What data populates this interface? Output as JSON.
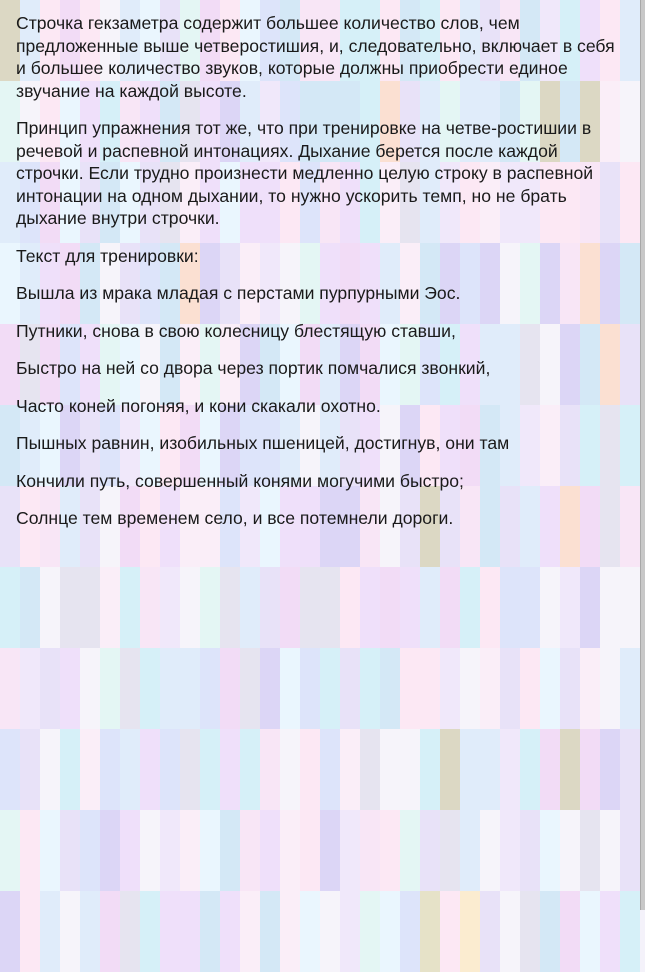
{
  "document": {
    "paragraphs": [
      "Строчка гекзаметра содержит большее количество слов, чем предложенные выше четверостишия, и, следовательно, включает в себя и большее количество звуков, которые должны приобрести единое звучание на каждой высоте.",
      "Принцип упражнения тот же, что при тренировке на четве-ростишии в речевой и распевной интонациях. Дыхание берется после каждой строчки. Если трудно произнести медленно целую строку в распевной интонации на одном дыхании, то нужно ускорить темп, но не брать дыхание внутри строчки."
    ],
    "training_label": "Текст для тренировки:",
    "verse_lines": [
      "Вышла из мрака младая с перстами пурпурными Эос.",
      "Путники, снова в свою колесницу блестящую ставши,",
      "Быстро на ней со двора через портик помчалися звонкий,",
      "Часто коней погоняя, и кони скакали охотно.",
      "Пышных равнин, изобильных пшеницей, достигнув, они там",
      "Кончили путь, совершенный конями могучими быстро;",
      "Солнце тем временем село, и все потемнели дороги."
    ]
  }
}
